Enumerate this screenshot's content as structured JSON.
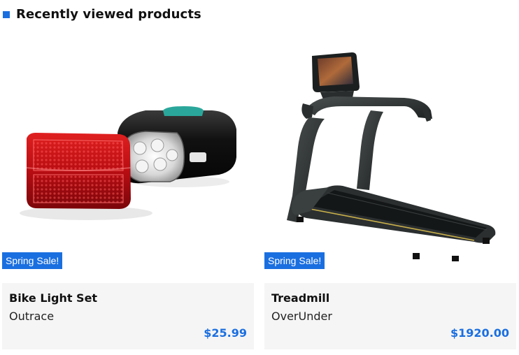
{
  "section": {
    "title": "Recently viewed products"
  },
  "products": [
    {
      "badge": "Spring Sale!",
      "name": "Bike Light Set",
      "brand": "Outrace",
      "price": "$25.99",
      "image_icon": "bike-light-image"
    },
    {
      "badge": "Spring Sale!",
      "name": "Treadmill",
      "brand": "OverUnder",
      "price": "$1920.00",
      "image_icon": "treadmill-image"
    }
  ],
  "colors": {
    "accent": "#1a6fe0",
    "card_bg": "#f5f5f5"
  }
}
